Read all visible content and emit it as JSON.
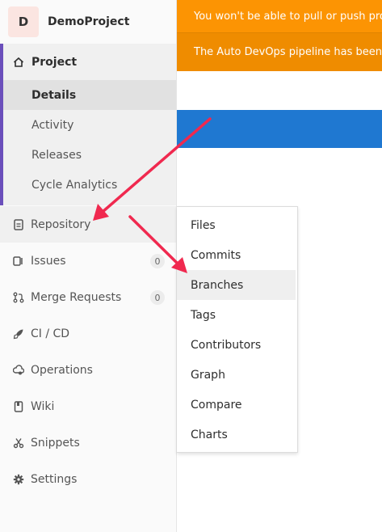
{
  "project": {
    "avatar_letter": "D",
    "name": "DemoProject"
  },
  "banners": {
    "warning": "You won't be able to pull or push project code via SSH until you add an SSH key to your profile",
    "devops": "The Auto DevOps pipeline has been enabled and will be used if no alternative CI configuration file is found."
  },
  "sidebar": {
    "project": {
      "label": "Project",
      "icon": "home-icon",
      "items": [
        "Details",
        "Activity",
        "Releases",
        "Cycle Analytics"
      ]
    },
    "repository": {
      "label": "Repository",
      "icon": "document-icon"
    },
    "issues": {
      "label": "Issues",
      "icon": "issues-icon",
      "count": "0"
    },
    "merge_requests": {
      "label": "Merge Requests",
      "icon": "merge-request-icon",
      "count": "0"
    },
    "cicd": {
      "label": "CI / CD",
      "icon": "rocket-icon"
    },
    "operations": {
      "label": "Operations",
      "icon": "cloud-gear-icon"
    },
    "wiki": {
      "label": "Wiki",
      "icon": "book-icon"
    },
    "snippets": {
      "label": "Snippets",
      "icon": "scissors-icon"
    },
    "settings": {
      "label": "Settings",
      "icon": "gear-icon"
    }
  },
  "flyout": {
    "items": [
      "Files",
      "Commits",
      "Branches",
      "Tags",
      "Contributors",
      "Graph",
      "Compare",
      "Charts"
    ],
    "highlighted": "Branches"
  },
  "colors": {
    "warning_banner": "#fc9403",
    "devops_banner": "#ef8c00",
    "blue_bar": "#1f78d1",
    "arrow": "#f0294f",
    "active_bar": "#6b4fbb"
  }
}
